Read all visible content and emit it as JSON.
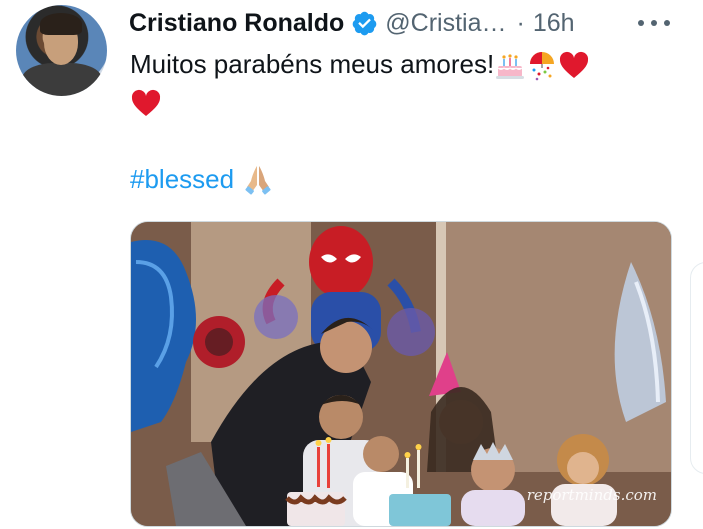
{
  "tweet": {
    "author_name": "Cristiano Ronaldo",
    "handle": "@Cristia…",
    "separator": "·",
    "time": "16h",
    "text": "Muitos parabéns meus amores!",
    "hashtag": "#blessed",
    "emojis_line1": [
      "birthday-cake-emoji",
      "confetti-ball-emoji",
      "red-heart-emoji"
    ],
    "emojis_line2": [
      "red-heart-emoji"
    ],
    "hashtag_emoji": "folded-hands-emoji"
  },
  "photo": {
    "watermark": "reportminds.com"
  },
  "colors": {
    "text": "#0f1419",
    "secondary": "#536471",
    "accent": "#1d9bf0",
    "verified": "#1d9bf0",
    "heart": "#e0182d"
  }
}
